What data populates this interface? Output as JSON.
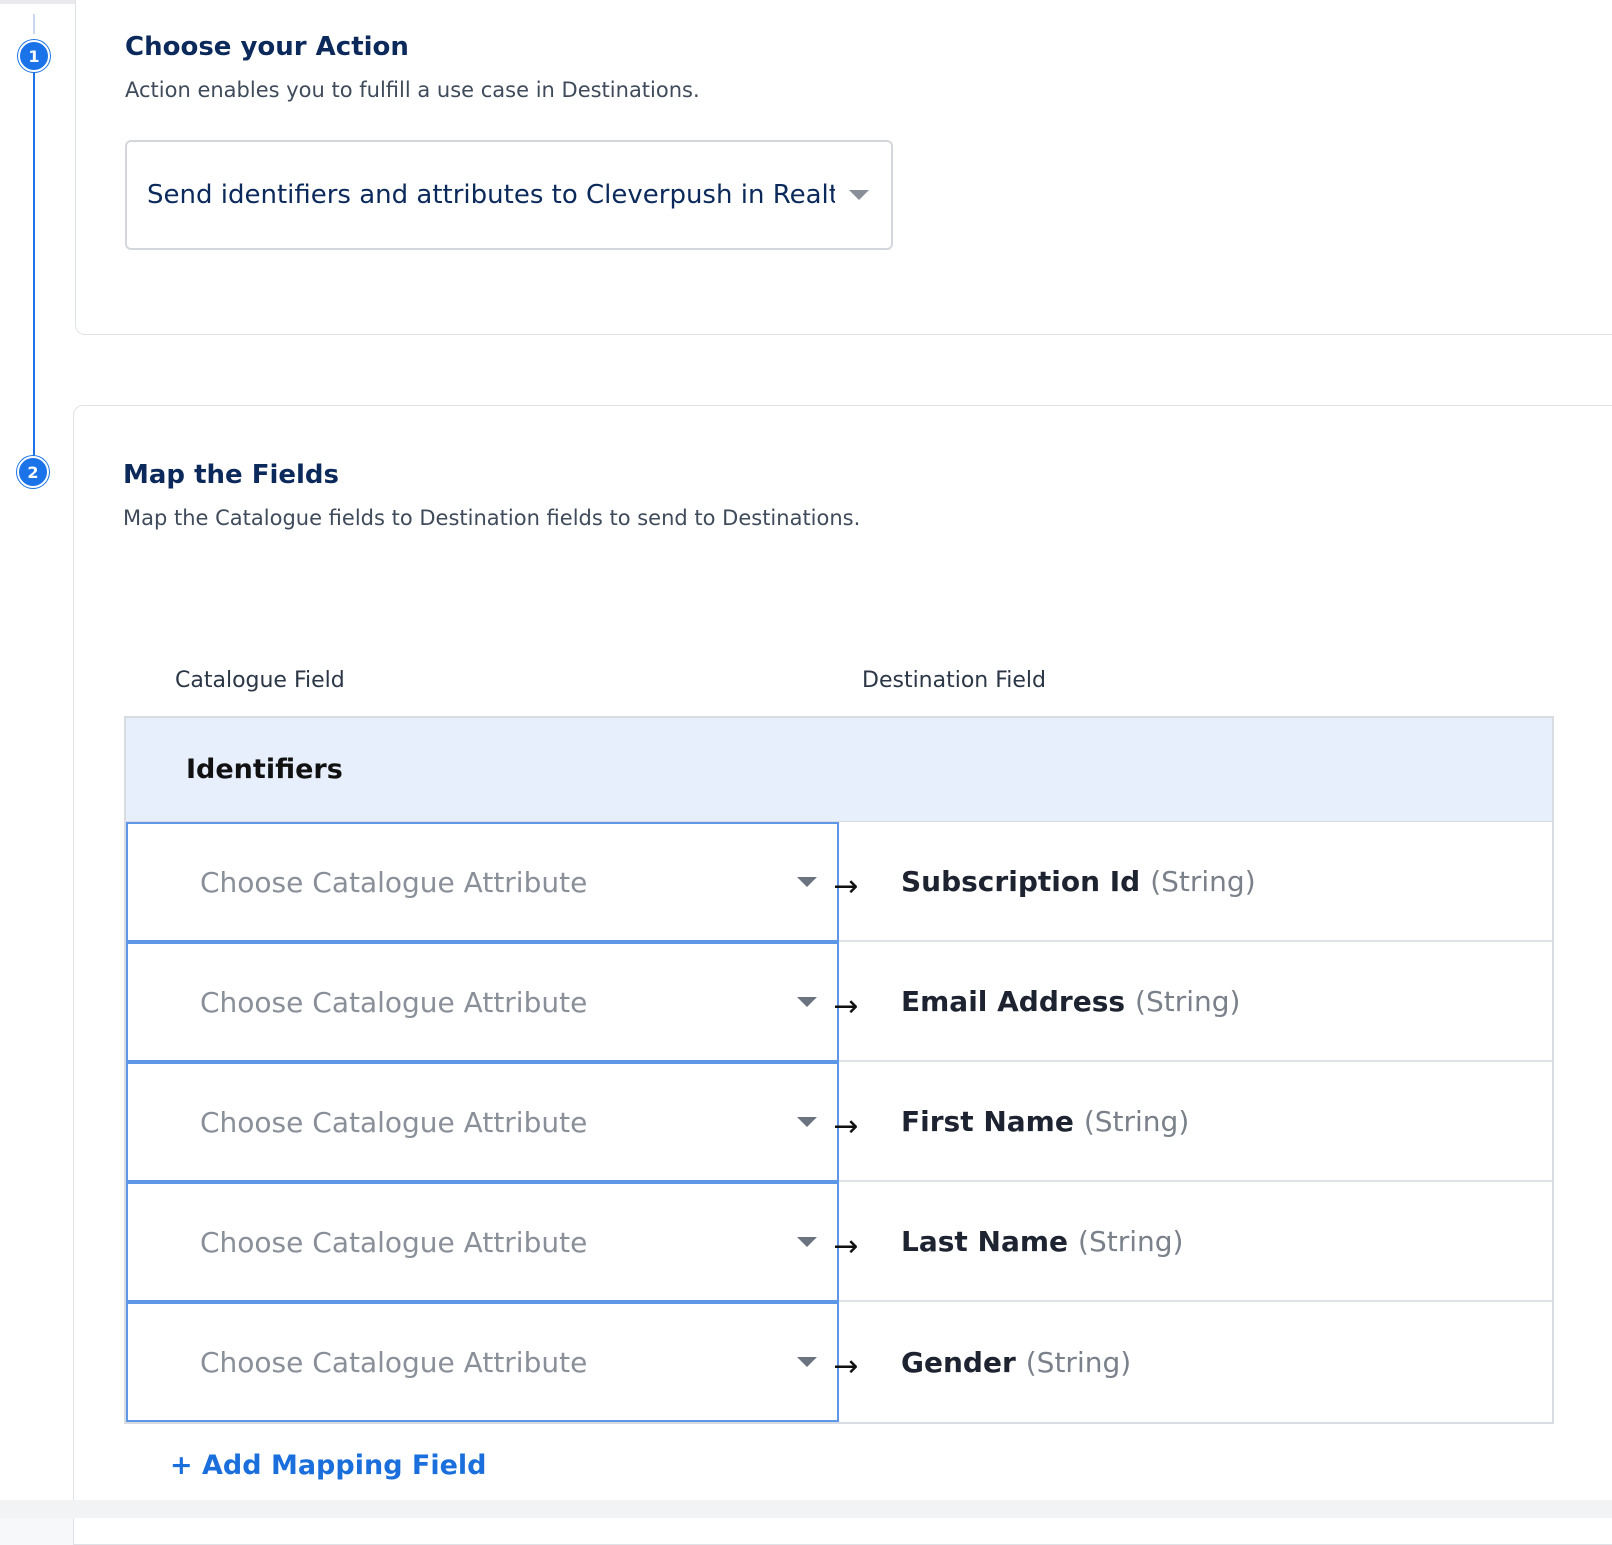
{
  "steps": {
    "step1_number": "1",
    "step2_number": "2"
  },
  "action_section": {
    "title": "Choose your Action",
    "subtitle": "Action enables you to fulfill a use case in Destinations.",
    "selected_action": "Send identifiers and attributes to Cleverpush in Realt..."
  },
  "mapping_section": {
    "title": "Map the Fields",
    "subtitle": "Map the Catalogue fields to Destination fields to send to Destinations.",
    "left_column_header": "Catalogue Field",
    "right_column_header": "Destination Field",
    "group_label": "Identifiers",
    "rows": [
      {
        "placeholder": "Choose Catalogue Attribute",
        "arrow": "→",
        "field": "Subscription Id",
        "type": "(String)"
      },
      {
        "placeholder": "Choose Catalogue Attribute",
        "arrow": "→",
        "field": "Email Address",
        "type": "(String)"
      },
      {
        "placeholder": "Choose Catalogue Attribute",
        "arrow": "→",
        "field": "First Name",
        "type": "(String)"
      },
      {
        "placeholder": "Choose Catalogue Attribute",
        "arrow": "→",
        "field": "Last Name",
        "type": "(String)"
      },
      {
        "placeholder": "Choose Catalogue Attribute",
        "arrow": "→",
        "field": "Gender",
        "type": "(String)"
      }
    ],
    "add_mapping_label": "+ Add Mapping Field"
  },
  "colors": {
    "accent": "#1a73e8",
    "title": "#0b2a5b",
    "group_bg": "#e8effc"
  }
}
